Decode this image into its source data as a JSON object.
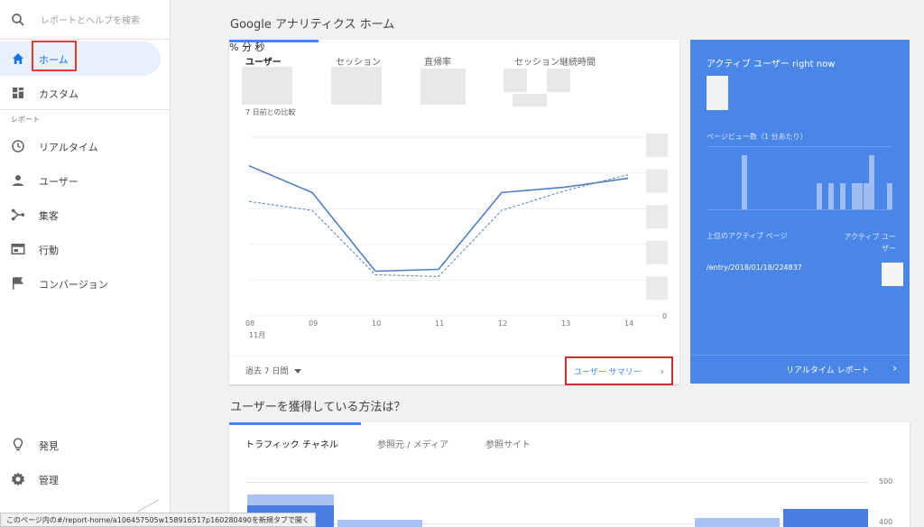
{
  "search": {
    "placeholder": "レポートとヘルプを検索"
  },
  "sidebar": {
    "items": [
      {
        "label": "ホーム",
        "icon": "home-icon"
      },
      {
        "label": "カスタム",
        "icon": "dashboard-icon"
      }
    ],
    "section_label": "レポート",
    "reports": [
      {
        "label": "リアルタイム",
        "icon": "clock-icon"
      },
      {
        "label": "ユーザー",
        "icon": "person-icon"
      },
      {
        "label": "集客",
        "icon": "acquisition-icon"
      },
      {
        "label": "行動",
        "icon": "behavior-icon"
      },
      {
        "label": "コンバージョン",
        "icon": "flag-icon"
      }
    ],
    "bottom": [
      {
        "label": "発見",
        "icon": "lightbulb-icon"
      },
      {
        "label": "管理",
        "icon": "gear-icon"
      }
    ]
  },
  "main": {
    "title": "Google アナリティクス ホーム",
    "metrics": {
      "users_label": "ユーザー",
      "sessions_label": "セッション",
      "bounce_label": "直帰率",
      "bounce_unit": "%",
      "duration_label": "セッション継続時間",
      "min_unit": "分",
      "sec_unit": "秒",
      "compare_label": "7 日前との比較"
    },
    "chart_data": {
      "type": "line",
      "x": [
        "08",
        "09",
        "10",
        "11",
        "12",
        "13",
        "14"
      ],
      "x_sublabel": "11月",
      "series": [
        {
          "style": "solid",
          "values": [
            0.84,
            0.69,
            0.25,
            0.26,
            0.69,
            0.72,
            0.77
          ]
        },
        {
          "style": "dashed",
          "values": [
            0.64,
            0.59,
            0.23,
            0.22,
            0.59,
            0.7,
            0.79
          ]
        }
      ],
      "y_zero_label": "0",
      "ylim": [
        0,
        1
      ]
    },
    "footer": {
      "range": "過去 7 日間",
      "link": "ユーザー サマリー"
    }
  },
  "realtime": {
    "title": "アクティブ ユーザー right now",
    "pageviews_label": "ページビュー数（1 分あたり）",
    "pageview_bars": [
      0,
      0,
      0,
      0,
      0,
      0,
      1,
      0,
      0,
      0,
      0,
      0,
      0,
      0,
      0,
      0,
      0,
      0,
      0,
      0.48,
      0,
      0.48,
      0,
      0.48,
      0,
      0.48,
      0.48,
      0.48,
      1,
      0,
      0,
      0.48
    ],
    "col_page": "上位のアクティブ ページ",
    "col_users": "アクティブ ユーザー",
    "top_page": "/entry/2018/01/18/224837",
    "footer_link": "リアルタイム レポート"
  },
  "acquisition": {
    "title": "ユーザーを獲得している方法は？",
    "tabs": [
      "トラフィック チャネル",
      "参照元 / メディア",
      "参照サイト"
    ],
    "y_ticks": [
      "500",
      "400"
    ]
  },
  "status_bar": "このページ内の#/report-home/a106457505w158916517p160280490を新規タブで開く"
}
